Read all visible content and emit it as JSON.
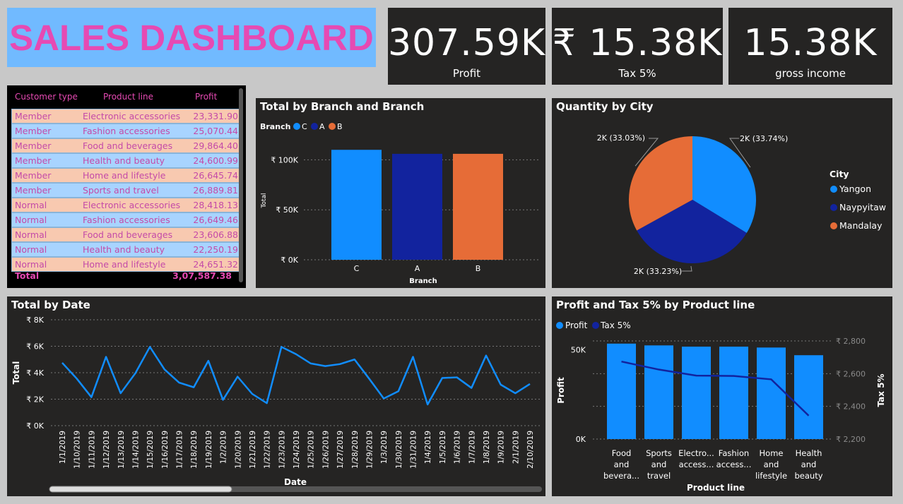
{
  "title": "SALES DASHBOARD",
  "cards": [
    {
      "value": "307.59K",
      "label": "Profit"
    },
    {
      "value": "₹ 15.38K",
      "label": "Tax 5%"
    },
    {
      "value": "15.38K",
      "label": "gross income"
    }
  ],
  "table": {
    "headers": [
      "Customer type",
      "Product line",
      "Profit"
    ],
    "rows": [
      [
        "Member",
        "Electronic accessories",
        "23,331.90"
      ],
      [
        "Member",
        "Fashion accessories",
        "25,070.44"
      ],
      [
        "Member",
        "Food and beverages",
        "29,864.40"
      ],
      [
        "Member",
        "Health and beauty",
        "24,600.99"
      ],
      [
        "Member",
        "Home and lifestyle",
        "26,645.74"
      ],
      [
        "Member",
        "Sports and travel",
        "26,889.81"
      ],
      [
        "Normal",
        "Electronic accessories",
        "28,418.13"
      ],
      [
        "Normal",
        "Fashion accessories",
        "26,649.46"
      ],
      [
        "Normal",
        "Food and beverages",
        "23,606.88"
      ],
      [
        "Normal",
        "Health and beauty",
        "22,250.19"
      ],
      [
        "Normal",
        "Home and lifestyle",
        "24,651.32"
      ]
    ],
    "total_label": "Total",
    "total_value": "3,07,587.38",
    "row_colors": [
      "#f8c9b0",
      "#a8d4ff"
    ]
  },
  "colors": {
    "c": "#118dff",
    "a": "#12239e",
    "b": "#e66c37",
    "line": "#118dff",
    "tax": "#12239e"
  },
  "chart_data": [
    {
      "type": "bar",
      "title": "Total by Branch and Branch",
      "legend_title": "Branch",
      "legend": [
        "C",
        "A",
        "B"
      ],
      "categories": [
        "C",
        "A",
        "B"
      ],
      "values": [
        110000,
        106000,
        106000
      ],
      "xlabel": "Branch",
      "ylabel": "Total",
      "yticks": [
        "₹ 0K",
        "₹ 50K",
        "₹ 100K"
      ],
      "ylim": [
        0,
        125000
      ]
    },
    {
      "type": "pie",
      "title": "Quantity by City",
      "legend_title": "City",
      "labels": [
        "Yangon",
        "Naypyitaw",
        "Mandalay"
      ],
      "values": [
        33.74,
        33.23,
        33.03
      ],
      "data_labels": [
        "2K (33.74%)",
        "2K (33.23%)",
        "2K (33.03%)"
      ]
    },
    {
      "type": "line",
      "title": "Total by Date",
      "xlabel": "Date",
      "ylabel": "Total",
      "yticks": [
        "₹ 0K",
        "₹ 2K",
        "₹ 4K",
        "₹ 6K",
        "₹ 8K"
      ],
      "ylim": [
        0,
        8000
      ],
      "x": [
        "1/1/2019",
        "1/10/2019",
        "1/11/2019",
        "1/12/2019",
        "1/13/2019",
        "1/14/2019",
        "1/15/2019",
        "1/16/2019",
        "1/17/2019",
        "1/18/2019",
        "1/19/2019",
        "1/2/2019",
        "1/20/2019",
        "1/21/2019",
        "1/22/2019",
        "1/23/2019",
        "1/24/2019",
        "1/25/2019",
        "1/26/2019",
        "1/27/2019",
        "1/28/2019",
        "1/29/2019",
        "1/3/2019",
        "1/30/2019",
        "1/31/2019",
        "1/4/2019",
        "1/5/2019",
        "1/6/2019",
        "1/7/2019",
        "1/8/2019",
        "1/9/2019",
        "2/1/2019",
        "2/10/2019"
      ],
      "values": [
        4750,
        3550,
        2150,
        5200,
        2450,
        3950,
        5950,
        4250,
        3250,
        2900,
        4900,
        1950,
        3700,
        2400,
        1700,
        5950,
        5400,
        4700,
        4500,
        4650,
        5000,
        3550,
        2050,
        2600,
        5200,
        1600,
        3600,
        3650,
        2850,
        5300,
        3100,
        2450,
        3150
      ]
    },
    {
      "type": "bar",
      "title": "Profit and Tax 5% by Product line",
      "legend": [
        "Profit",
        "Tax 5%"
      ],
      "categories": [
        "Food and bevera...",
        "Sports and travel",
        "Electro... access...",
        "Fashion access...",
        "Home and lifestyle",
        "Health and beauty"
      ],
      "series": [
        {
          "name": "Profit",
          "values": [
            53500,
            52500,
            51800,
            51800,
            51300,
            47000
          ]
        },
        {
          "name": "Tax 5%",
          "values": [
            2674,
            2625,
            2588,
            2586,
            2565,
            2343
          ]
        }
      ],
      "xlabel": "Product line",
      "ylabel": "Profit",
      "ylabel2": "Tax 5%",
      "yticks": [
        "0K",
        "50K"
      ],
      "ylim": [
        0,
        55000
      ],
      "y2ticks": [
        "₹ 2,200",
        "₹ 2,400",
        "₹ 2,600",
        "₹ 2,800"
      ],
      "y2lim": [
        2200,
        2800
      ]
    }
  ]
}
